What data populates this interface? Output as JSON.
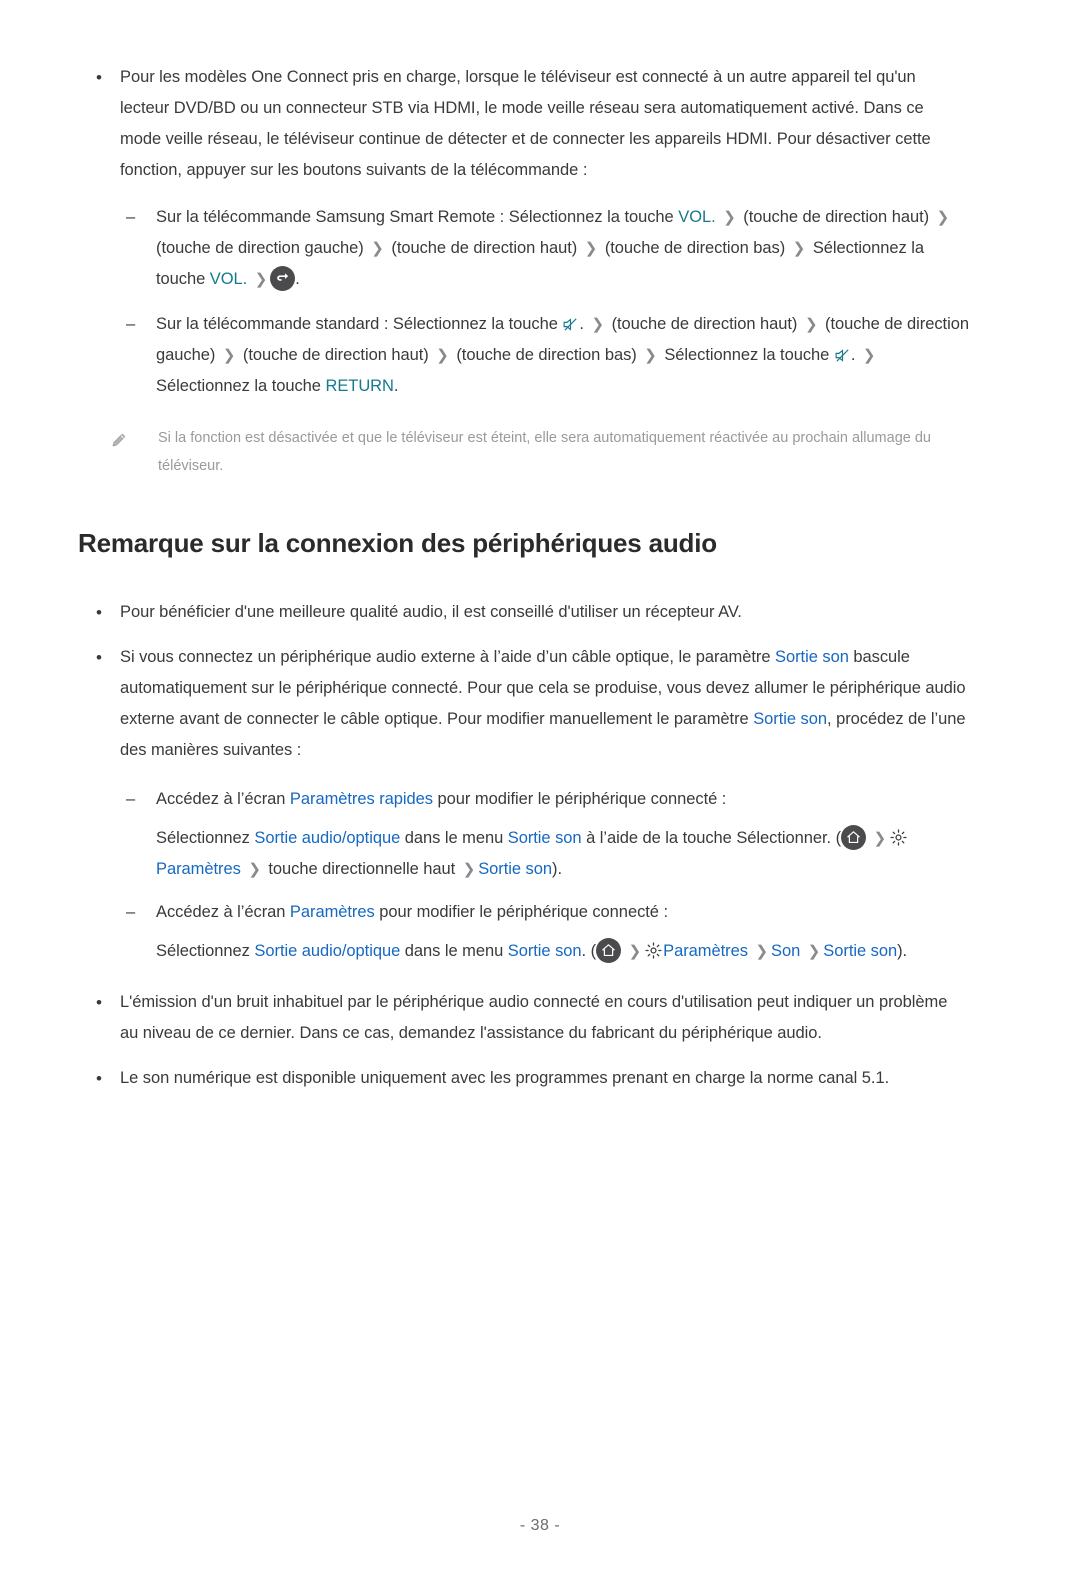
{
  "document": {
    "language": "fr",
    "page_number": "- 38 -",
    "body_color": "#3a3a3c",
    "accent_teal": "#17798c",
    "accent_blue": "#1668c2",
    "note_color": "#9a9a9d"
  },
  "section_one": {
    "bullet": {
      "marker": "•",
      "text": "Pour les modèles One Connect pris en charge, lorsque le téléviseur est connecté à un autre appareil tel qu'un lecteur DVD/BD ou un connecteur STB via HDMI, le mode veille réseau sera automatiquement activé. Dans ce mode veille réseau, le téléviseur continue de détecter et de connecter les appareils HDMI. Pour désactiver cette fonction, appuyer sur les boutons suivants de la télécommande :"
    },
    "smart_remote": {
      "marker": "–",
      "part1": "Sur la télécommande Samsung Smart Remote : Sélectionnez la touche ",
      "vol1": "VOL.",
      "chevron": "❯",
      "part2": "(touche de direction haut)",
      "part3": "(touche de direction gauche)",
      "part4": "(touche de direction haut)",
      "part5": "(touche de direction bas)",
      "part6": "Sélectionnez la touche ",
      "vol2": "VOL.",
      "return_icon_name": "return-icon",
      "end": "."
    },
    "standard_remote": {
      "marker": "–",
      "part1": "Sur la télécommande standard : Sélectionnez la touche ",
      "mute_icon_name": "mute-icon",
      "dot1": ".",
      "chevron": "❯",
      "part2": "(touche de direction haut)",
      "part3": "(touche de",
      "part4": "direction gauche)",
      "part5": "(touche de direction haut)",
      "part6": "(touche de direction bas)",
      "part7": "Sélectionnez la touche ",
      "dot2": ".",
      "part8": "Sélectionnez la touche ",
      "return_label": "RETURN",
      "end": "."
    },
    "note": {
      "icon_name": "pencil-icon",
      "text": "Si la fonction est désactivée et que le téléviseur est éteint, elle sera automatiquement réactivée au prochain allumage du téléviseur."
    }
  },
  "heading": "Remarque sur la connexion des périphériques audio",
  "section_two": {
    "bullet_av": {
      "marker": "•",
      "text": "Pour bénéficier d'une meilleure qualité audio, il est conseillé d'utiliser un récepteur AV."
    },
    "bullet_optical": {
      "marker": "•",
      "part1": "Si vous connectez un périphérique audio externe à l’aide d’un câble optique, le paramètre ",
      "link1": "Sortie son",
      "part2": " bascule automatiquement sur le périphérique connecté. Pour que cela se produise, vous devez allumer le périphérique audio externe avant de connecter le câble optique. Pour modifier manuellement le paramètre ",
      "link2": "Sortie son",
      "part3": ", procédez de l’une des manières suivantes :"
    },
    "quick_settings": {
      "marker": "–",
      "line1_part1": "Accédez à l’écran ",
      "line1_link": "Paramètres rapides",
      "line1_part2": " pour modifier le périphérique connecté :",
      "line2_part1": "Sélectionnez ",
      "line2_link1": "Sortie audio/optique",
      "line2_part2": " dans le menu ",
      "line2_link2": "Sortie son",
      "line2_part3": " à l’aide de la touche Sélectionner. (",
      "home_icon_name": "home-icon",
      "chevron": "❯",
      "gear_icon_name": "gear-icon",
      "line3_link1": "Paramètres",
      "line3_part1": " touche directionnelle haut ",
      "line3_link2": "Sortie son",
      "line3_part2": ")."
    },
    "settings": {
      "marker": "–",
      "line1_part1": "Accédez à l’écran ",
      "line1_link": "Paramètres",
      "line1_part2": " pour modifier le périphérique connecté :",
      "line2_part1": "Sélectionnez ",
      "line2_link1": "Sortie audio/optique",
      "line2_part2": " dans le menu ",
      "line2_link2": "Sortie son",
      "line2_part3": ". (",
      "home_icon_name": "home-icon",
      "chevron": "❯",
      "gear_icon_name": "gear-icon",
      "link_parametres": "Paramètres",
      "link_son": "Son",
      "link_sortie_son": "Sortie son",
      "line_end": ")."
    },
    "bullet_noise": {
      "marker": "•",
      "text": "L'émission d'un bruit inhabituel par le périphérique audio connecté en cours d'utilisation peut indiquer un problème au niveau de ce dernier. Dans ce cas, demandez l'assistance du fabricant du périphérique audio."
    },
    "bullet_digital": {
      "marker": "•",
      "text": "Le son numérique est disponible uniquement avec les programmes prenant en charge la norme canal 5.1."
    }
  }
}
